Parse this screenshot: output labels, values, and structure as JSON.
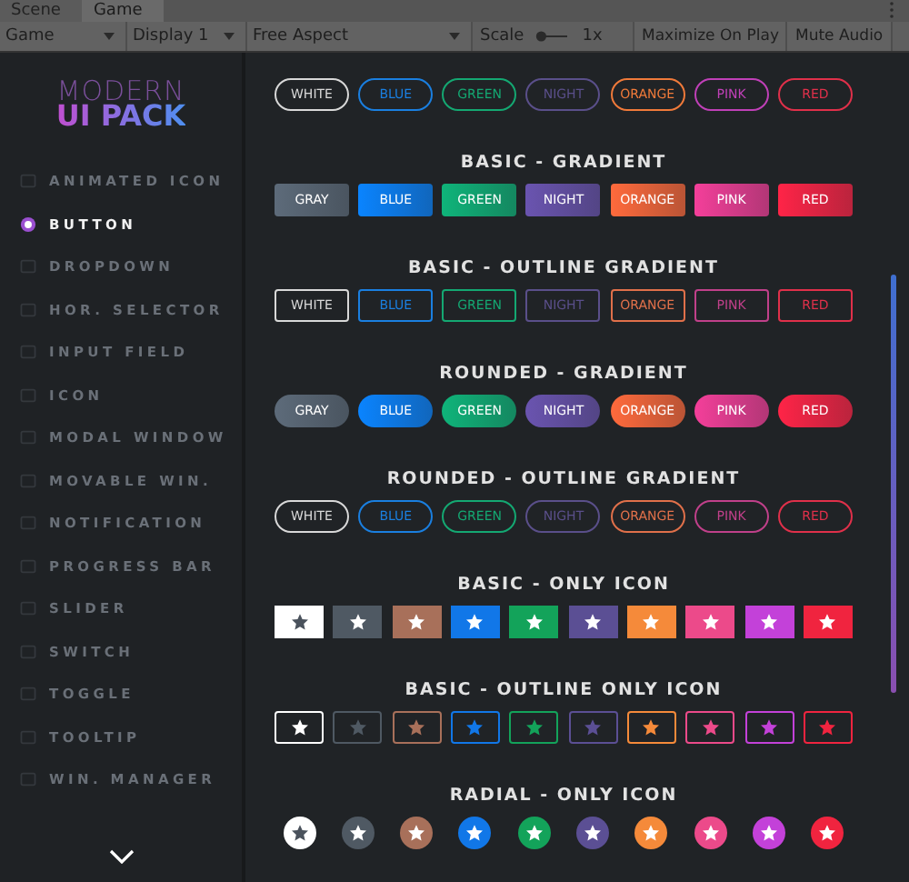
{
  "editor_tabs": [
    {
      "label": "Scene",
      "selected": false
    },
    {
      "label": "Game",
      "selected": true
    }
  ],
  "toolbar": {
    "view": "Game",
    "display": "Display 1",
    "aspect": "Free Aspect",
    "scale_label": "Scale",
    "scale_slider": {
      "level": 0.05
    },
    "scale_value": "1x",
    "buttons": [
      "Maximize On Play",
      "Mute Audio"
    ]
  },
  "logo": {
    "line1": "MODERN",
    "line2": "UI PACK"
  },
  "sidebar": {
    "items": [
      {
        "label": "ANIMATED ICON",
        "selected": false
      },
      {
        "label": "BUTTON",
        "selected": true
      },
      {
        "label": "DROPDOWN",
        "selected": false
      },
      {
        "label": "HOR. SELECTOR",
        "selected": false
      },
      {
        "label": "INPUT FIELD",
        "selected": false
      },
      {
        "label": "ICON",
        "selected": false
      },
      {
        "label": "MODAL WINDOW",
        "selected": false
      },
      {
        "label": "MOVABLE WIN.",
        "selected": false
      },
      {
        "label": "NOTIFICATION",
        "selected": false
      },
      {
        "label": "PROGRESS BAR",
        "selected": false
      },
      {
        "label": "SLIDER",
        "selected": false
      },
      {
        "label": "SWITCH",
        "selected": false
      },
      {
        "label": "TOGGLE",
        "selected": false
      },
      {
        "label": "TOOLTIP",
        "selected": false
      },
      {
        "label": "WIN. MANAGER",
        "selected": false
      }
    ]
  },
  "sections": [
    {
      "kind": "rounded_outline",
      "buttons": [
        {
          "label": "WHITE",
          "color": "#d8d8d8"
        },
        {
          "label": "BLUE",
          "color": "#1a7fe0"
        },
        {
          "label": "GREEN",
          "color": "#14a872"
        },
        {
          "label": "NIGHT",
          "color": "#5a4f8a"
        },
        {
          "label": "ORANGE",
          "color": "#f07a3a"
        },
        {
          "label": "PINK",
          "color": "#c040b8"
        },
        {
          "label": "RED",
          "color": "#e0304a"
        }
      ]
    },
    {
      "title": "BASIC - GRADIENT",
      "kind": "gradient",
      "buttons": [
        {
          "label": "GRAY",
          "color": "#5d6b7a"
        },
        {
          "label": "BLUE",
          "color": "#0a84ff"
        },
        {
          "label": "GREEN",
          "color": "#0fb47a"
        },
        {
          "label": "NIGHT",
          "color": "#6a54b0"
        },
        {
          "label": "ORANGE",
          "color": "#ff6a3c"
        },
        {
          "label": "PINK",
          "color": "#f43f9a"
        },
        {
          "label": "RED",
          "color": "#ff2447"
        }
      ]
    },
    {
      "title": "BASIC - OUTLINE GRADIENT",
      "kind": "outline",
      "buttons": [
        {
          "label": "WHITE",
          "color": "#d8d8d8"
        },
        {
          "label": "BLUE",
          "color": "#1a7fe0"
        },
        {
          "label": "GREEN",
          "color": "#14a872"
        },
        {
          "label": "NIGHT",
          "color": "#5a4f8a"
        },
        {
          "label": "ORANGE",
          "color": "#e0704a"
        },
        {
          "label": "PINK",
          "color": "#c0408a"
        },
        {
          "label": "RED",
          "color": "#e0304a"
        }
      ]
    },
    {
      "title": "ROUNDED - GRADIENT",
      "kind": "rounded_gradient",
      "buttons": [
        {
          "label": "GRAY",
          "color": "#5d6b7a"
        },
        {
          "label": "BLUE",
          "color": "#0a84ff"
        },
        {
          "label": "GREEN",
          "color": "#0fb47a"
        },
        {
          "label": "NIGHT",
          "color": "#6a54b0"
        },
        {
          "label": "ORANGE",
          "color": "#ff6a3c"
        },
        {
          "label": "PINK",
          "color": "#f43f9a"
        },
        {
          "label": "RED",
          "color": "#ff2447"
        }
      ]
    },
    {
      "title": "ROUNDED - OUTLINE GRADIENT",
      "kind": "rounded_outline",
      "buttons": [
        {
          "label": "WHITE",
          "color": "#d8d8d8"
        },
        {
          "label": "BLUE",
          "color": "#1a7fe0"
        },
        {
          "label": "GREEN",
          "color": "#14a872"
        },
        {
          "label": "NIGHT",
          "color": "#5a4f8a"
        },
        {
          "label": "ORANGE",
          "color": "#e0704a"
        },
        {
          "label": "PINK",
          "color": "#c0408a"
        },
        {
          "label": "RED",
          "color": "#e0304a"
        }
      ]
    },
    {
      "title": "BASIC - ONLY ICON",
      "kind": "icon",
      "buttons": [
        {
          "color": "#ffffff"
        },
        {
          "color": "#4f5963"
        },
        {
          "color": "#a8705a"
        },
        {
          "color": "#1177e8"
        },
        {
          "color": "#13a35a"
        },
        {
          "color": "#5b4f94"
        },
        {
          "color": "#f58a3a"
        },
        {
          "color": "#ec4a8a"
        },
        {
          "color": "#c341d9"
        },
        {
          "color": "#f0243f"
        }
      ]
    },
    {
      "title": "BASIC - OUTLINE ONLY ICON",
      "kind": "outline_icon",
      "buttons": [
        {
          "color": "#ffffff"
        },
        {
          "color": "#4f5963"
        },
        {
          "color": "#a8705a"
        },
        {
          "color": "#1177e8"
        },
        {
          "color": "#13a35a"
        },
        {
          "color": "#5b4f94"
        },
        {
          "color": "#f58a3a"
        },
        {
          "color": "#ec4a8a"
        },
        {
          "color": "#c341d9"
        },
        {
          "color": "#f0243f"
        }
      ]
    },
    {
      "title": "RADIAL - ONLY ICON",
      "kind": "radial_icon",
      "buttons": [
        {
          "color": "#ffffff"
        },
        {
          "color": "#4f5963"
        },
        {
          "color": "#a8705a"
        },
        {
          "color": "#1177e8"
        },
        {
          "color": "#13a35a"
        },
        {
          "color": "#5b4f94"
        },
        {
          "color": "#f58a3a"
        },
        {
          "color": "#ec4a8a"
        },
        {
          "color": "#c341d9"
        },
        {
          "color": "#f0243f"
        }
      ]
    }
  ]
}
